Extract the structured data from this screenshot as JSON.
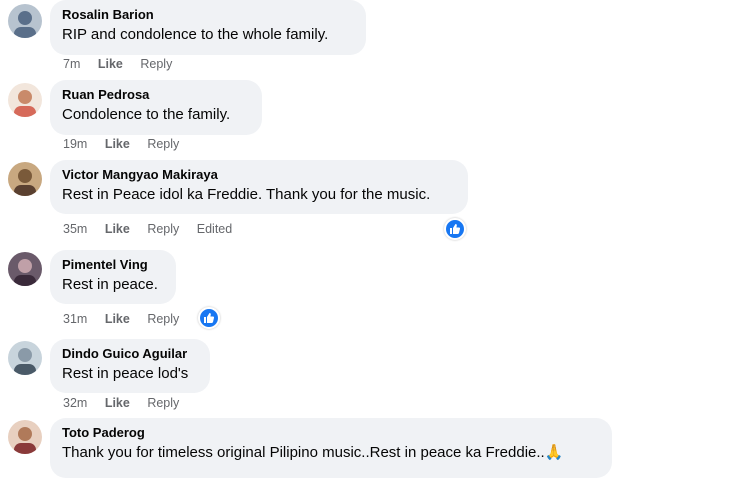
{
  "comments": [
    {
      "author": "Rosalin Barion",
      "text": "RIP and condolence to the whole family.",
      "time": "7m",
      "like": "Like",
      "reply": "Reply",
      "edited": "",
      "avatar_icon": "user-avatar",
      "avatar_color": "#5a6f8a"
    },
    {
      "author": "Ruan Pedrosa",
      "text": "Condolence to the family.",
      "time": "19m",
      "like": "Like",
      "reply": "Reply",
      "edited": "",
      "avatar_icon": "user-avatar",
      "avatar_color": "#c98a6a"
    },
    {
      "author": "Victor Mangyao Makiraya",
      "text": "Rest in Peace idol ka Freddie. Thank you for the music.",
      "time": "35m",
      "like": "Like",
      "reply": "Reply",
      "edited": "Edited",
      "avatar_icon": "user-avatar",
      "avatar_color": "#7a5a3a",
      "reaction": "like-reaction-icon"
    },
    {
      "author": "Pimentel Ving",
      "text": "Rest in peace.",
      "time": "31m",
      "like": "Like",
      "reply": "Reply",
      "edited": "",
      "avatar_icon": "user-avatar",
      "avatar_color": "#4a3a4a",
      "reaction": "like-reaction-icon"
    },
    {
      "author": "Dindo Guico Aguilar",
      "text": "Rest in peace lod's",
      "time": "32m",
      "like": "Like",
      "reply": "Reply",
      "edited": "",
      "avatar_icon": "user-avatar",
      "avatar_color": "#8a9aa8"
    },
    {
      "author": "Toto Paderog",
      "text": "Thank you for timeless original Pilipino music..Rest in peace ka Freddie..🙏",
      "time": "",
      "like": "",
      "reply": "",
      "edited": "",
      "avatar_icon": "user-avatar",
      "avatar_color": "#b07a5a"
    }
  ],
  "colors": {
    "bubble": "#f0f2f5",
    "meta": "#65676b",
    "like_blue": "#1877f2"
  }
}
